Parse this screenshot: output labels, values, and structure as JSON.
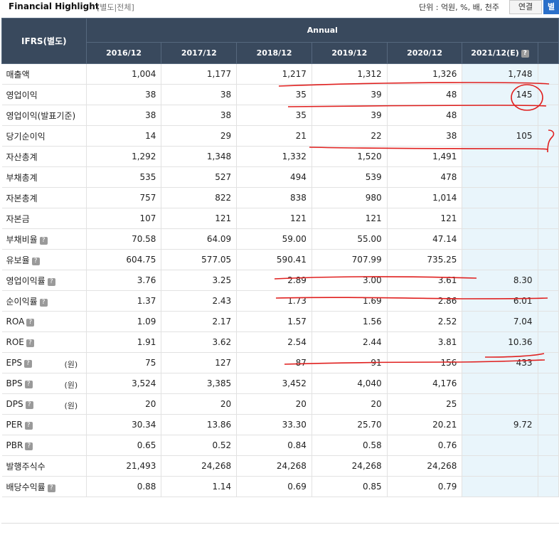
{
  "header": {
    "title": "Financial Highlight",
    "subtitle": "[별도|전체]",
    "unit": "단위 : 억원, %, 배, 천주",
    "btn_consolidated": "연결",
    "btn_separate": "별"
  },
  "table": {
    "corner_label": "IFRS(별도)",
    "group_label": "Annual",
    "years": [
      "2016/12",
      "2017/12",
      "2018/12",
      "2019/12",
      "2020/12",
      "2021/12(E)"
    ],
    "rows": [
      {
        "label": "매출액",
        "help": false,
        "unit": "",
        "values": [
          "1,004",
          "1,177",
          "1,217",
          "1,312",
          "1,326",
          "1,748"
        ]
      },
      {
        "label": "영업이익",
        "help": false,
        "unit": "",
        "values": [
          "38",
          "38",
          "35",
          "39",
          "48",
          "145"
        ]
      },
      {
        "label": "영업이익(발표기준)",
        "help": false,
        "unit": "",
        "values": [
          "38",
          "38",
          "35",
          "39",
          "48",
          ""
        ]
      },
      {
        "label": "당기순이익",
        "help": false,
        "unit": "",
        "values": [
          "14",
          "29",
          "21",
          "22",
          "38",
          "105"
        ]
      },
      {
        "label": "자산총계",
        "help": false,
        "unit": "",
        "values": [
          "1,292",
          "1,348",
          "1,332",
          "1,520",
          "1,491",
          ""
        ]
      },
      {
        "label": "부채총계",
        "help": false,
        "unit": "",
        "values": [
          "535",
          "527",
          "494",
          "539",
          "478",
          ""
        ]
      },
      {
        "label": "자본총계",
        "help": false,
        "unit": "",
        "values": [
          "757",
          "822",
          "838",
          "980",
          "1,014",
          ""
        ]
      },
      {
        "label": "자본금",
        "help": false,
        "unit": "",
        "values": [
          "107",
          "121",
          "121",
          "121",
          "121",
          ""
        ]
      },
      {
        "label": "부채비율",
        "help": true,
        "unit": "",
        "values": [
          "70.58",
          "64.09",
          "59.00",
          "55.00",
          "47.14",
          ""
        ]
      },
      {
        "label": "유보율",
        "help": true,
        "unit": "",
        "values": [
          "604.75",
          "577.05",
          "590.41",
          "707.99",
          "735.25",
          ""
        ]
      },
      {
        "label": "영업이익률",
        "help": true,
        "unit": "",
        "values": [
          "3.76",
          "3.25",
          "2.89",
          "3.00",
          "3.61",
          "8.30"
        ]
      },
      {
        "label": "순이익률",
        "help": true,
        "unit": "",
        "values": [
          "1.37",
          "2.43",
          "1.73",
          "1.69",
          "2.86",
          "6.01"
        ]
      },
      {
        "label": "ROA",
        "help": true,
        "unit": "",
        "values": [
          "1.09",
          "2.17",
          "1.57",
          "1.56",
          "2.52",
          "7.04"
        ]
      },
      {
        "label": "ROE",
        "help": true,
        "unit": "",
        "values": [
          "1.91",
          "3.62",
          "2.54",
          "2.44",
          "3.81",
          "10.36"
        ]
      },
      {
        "label": "EPS",
        "help": true,
        "unit": "(원)",
        "values": [
          "75",
          "127",
          "87",
          "91",
          "156",
          "433"
        ]
      },
      {
        "label": "BPS",
        "help": true,
        "unit": "(원)",
        "values": [
          "3,524",
          "3,385",
          "3,452",
          "4,040",
          "4,176",
          ""
        ]
      },
      {
        "label": "DPS",
        "help": true,
        "unit": "(원)",
        "values": [
          "20",
          "20",
          "20",
          "20",
          "25",
          ""
        ]
      },
      {
        "label": "PER",
        "help": true,
        "unit": "",
        "values": [
          "30.34",
          "13.86",
          "33.30",
          "25.70",
          "20.21",
          "9.72"
        ]
      },
      {
        "label": "PBR",
        "help": true,
        "unit": "",
        "values": [
          "0.65",
          "0.52",
          "0.84",
          "0.58",
          "0.76",
          ""
        ]
      },
      {
        "label": "발행주식수",
        "help": false,
        "unit": "",
        "values": [
          "21,493",
          "24,268",
          "24,268",
          "24,268",
          "24,268",
          ""
        ]
      },
      {
        "label": "배당수익률",
        "help": true,
        "unit": "",
        "values": [
          "0.88",
          "1.14",
          "0.69",
          "0.85",
          "0.79",
          ""
        ]
      }
    ]
  },
  "colors": {
    "header_bg": "#39495d",
    "estimate_bg": "#e9f5fb",
    "annotation": "#e0201f"
  }
}
